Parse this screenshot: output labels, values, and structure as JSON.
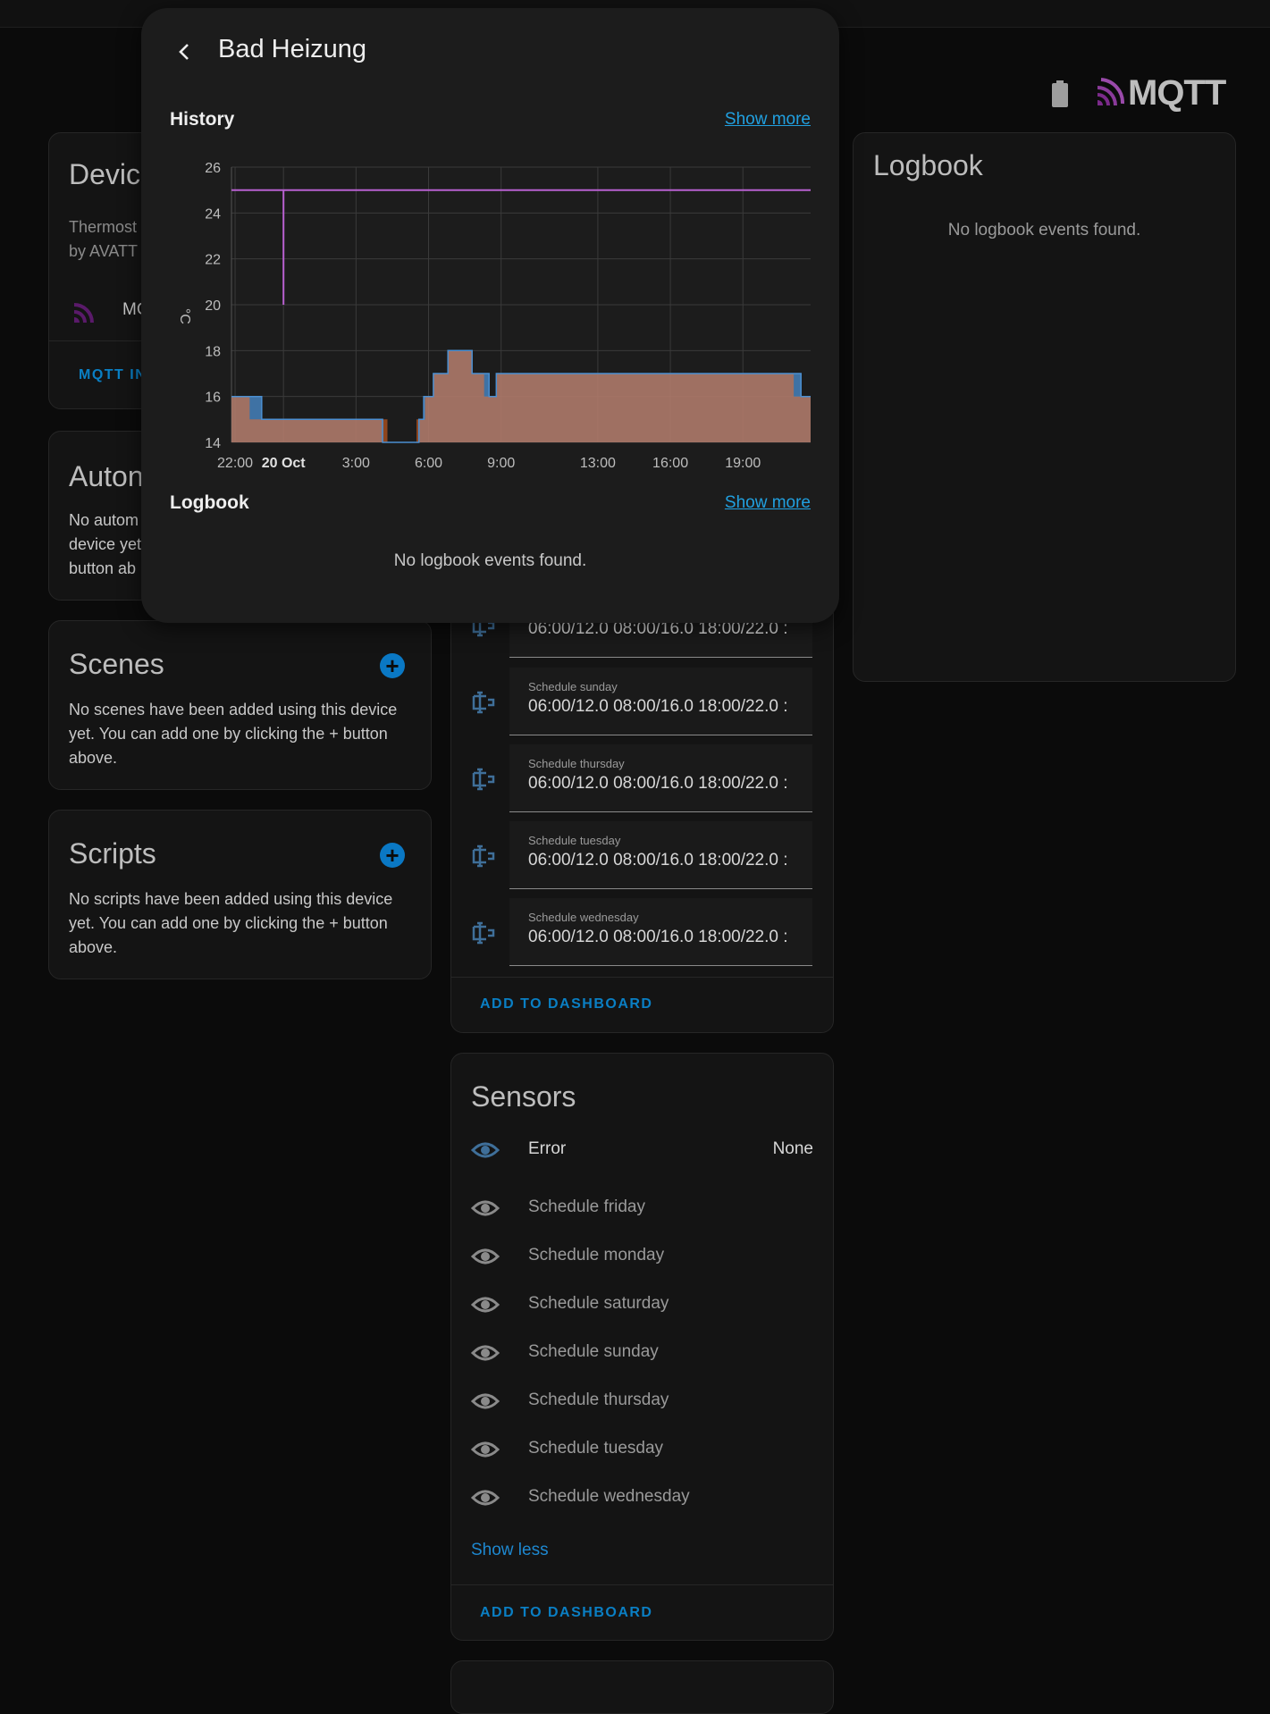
{
  "header": {
    "brand_text": "MQTT",
    "brand_color": "#7b2a8a",
    "battery_icon": "battery-icon"
  },
  "device_info": {
    "title": "Devic",
    "model_line1": "Thermost",
    "model_line2": "by AVATT",
    "integration_label": "MC",
    "mqtt_button": "MQTT IN"
  },
  "automations": {
    "title": "Auton",
    "text_line1": "No autom",
    "text_line2": "device yet",
    "text_line3": "button ab"
  },
  "scenes": {
    "title": "Scenes",
    "text_line1": "No scenes have been added using this device",
    "text_line2": "yet. You can add one by clicking the + button",
    "text_line3": "above."
  },
  "scripts": {
    "title": "Scripts",
    "text_line1": "No scripts have been added using this device",
    "text_line2": "yet. You can add one by clicking the + button",
    "text_line3": "above."
  },
  "controls": {
    "rows": [
      {
        "label": "",
        "value": "06:00/12.0 08:00/16.0 18:00/22.0 :"
      },
      {
        "label": "Schedule sunday",
        "value": "06:00/12.0 08:00/16.0 18:00/22.0 :"
      },
      {
        "label": "Schedule thursday",
        "value": "06:00/12.0 08:00/16.0 18:00/22.0 :"
      },
      {
        "label": "Schedule tuesday",
        "value": "06:00/12.0 08:00/16.0 18:00/22.0 :"
      },
      {
        "label": "Schedule wednesday",
        "value": "06:00/12.0 08:00/16.0 18:00/22.0 :"
      }
    ],
    "add_to_dashboard": "ADD TO DASHBOARD"
  },
  "sensors": {
    "title": "Sensors",
    "rows": [
      {
        "name": "Error",
        "state": "None"
      },
      {
        "name": "Schedule friday",
        "state": ""
      },
      {
        "name": "Schedule monday",
        "state": ""
      },
      {
        "name": "Schedule saturday",
        "state": ""
      },
      {
        "name": "Schedule sunday",
        "state": ""
      },
      {
        "name": "Schedule thursday",
        "state": ""
      },
      {
        "name": "Schedule tuesday",
        "state": ""
      },
      {
        "name": "Schedule wednesday",
        "state": ""
      }
    ],
    "show_less": "Show less",
    "add_to_dashboard": "ADD TO DASHBOARD"
  },
  "logbook_card": {
    "title": "Logbook",
    "empty_text": "No logbook events found."
  },
  "dialog": {
    "title": "Bad Heizung",
    "history_title": "History",
    "history_show_more": "Show more",
    "logbook_title": "Logbook",
    "logbook_show_more": "Show more",
    "logbook_empty": "No logbook events found."
  },
  "chart_data": {
    "type": "area",
    "ylabel": "°C",
    "ylim": [
      14,
      26
    ],
    "yticks": [
      "26",
      "24",
      "22",
      "20",
      "18",
      "16",
      "14"
    ],
    "xticks": [
      {
        "h": 0,
        "label": "22:00",
        "bold": false
      },
      {
        "h": 2,
        "label": "20 Oct",
        "bold": true
      },
      {
        "h": 5,
        "label": "3:00",
        "bold": false
      },
      {
        "h": 8,
        "label": "6:00",
        "bold": false
      },
      {
        "h": 11,
        "label": "9:00",
        "bold": false
      },
      {
        "h": 15,
        "label": "13:00",
        "bold": false
      },
      {
        "h": 18,
        "label": "16:00",
        "bold": false
      },
      {
        "h": 21,
        "label": "19:00",
        "bold": false
      }
    ],
    "xlim_hours": [
      -0.15,
      23.8
    ],
    "series": [
      {
        "name": "",
        "color": "#ff6e1f",
        "points": [
          [
            -0.15,
            16
          ],
          [
            0.6,
            16
          ],
          [
            0.6,
            15
          ],
          [
            6.3,
            15
          ],
          [
            6.3,
            14
          ],
          [
            7.5,
            14
          ],
          [
            7.5,
            15
          ],
          [
            7.85,
            15
          ],
          [
            7.85,
            16
          ],
          [
            8.2,
            16
          ],
          [
            8.2,
            17
          ],
          [
            8.8,
            17
          ],
          [
            8.8,
            18
          ],
          [
            9.8,
            18
          ],
          [
            9.8,
            17
          ],
          [
            10.3,
            17
          ],
          [
            10.3,
            16
          ],
          [
            10.8,
            16
          ],
          [
            10.8,
            17
          ],
          [
            23.1,
            17
          ],
          [
            23.1,
            16
          ],
          [
            23.8,
            16
          ]
        ]
      },
      {
        "name": "",
        "color": "#4b8fd1",
        "points": [
          [
            -0.15,
            16
          ],
          [
            1.1,
            16
          ],
          [
            1.1,
            15
          ],
          [
            6.1,
            15
          ],
          [
            6.1,
            14
          ],
          [
            7.6,
            14
          ],
          [
            7.6,
            15
          ],
          [
            7.8,
            15
          ],
          [
            7.8,
            16
          ],
          [
            8.2,
            16
          ],
          [
            8.2,
            17
          ],
          [
            8.8,
            17
          ],
          [
            8.8,
            18
          ],
          [
            9.8,
            18
          ],
          [
            9.8,
            17
          ],
          [
            10.5,
            17
          ],
          [
            10.5,
            16
          ],
          [
            10.8,
            16
          ],
          [
            10.8,
            17
          ],
          [
            23.4,
            17
          ],
          [
            23.4,
            16
          ],
          [
            23.8,
            16
          ]
        ]
      },
      {
        "name": "",
        "color": "#b860d0",
        "points": [
          [
            -0.15,
            25
          ],
          [
            2.0,
            25
          ],
          [
            2.0,
            20
          ],
          [
            2.0,
            25
          ],
          [
            23.8,
            25
          ]
        ]
      }
    ]
  }
}
